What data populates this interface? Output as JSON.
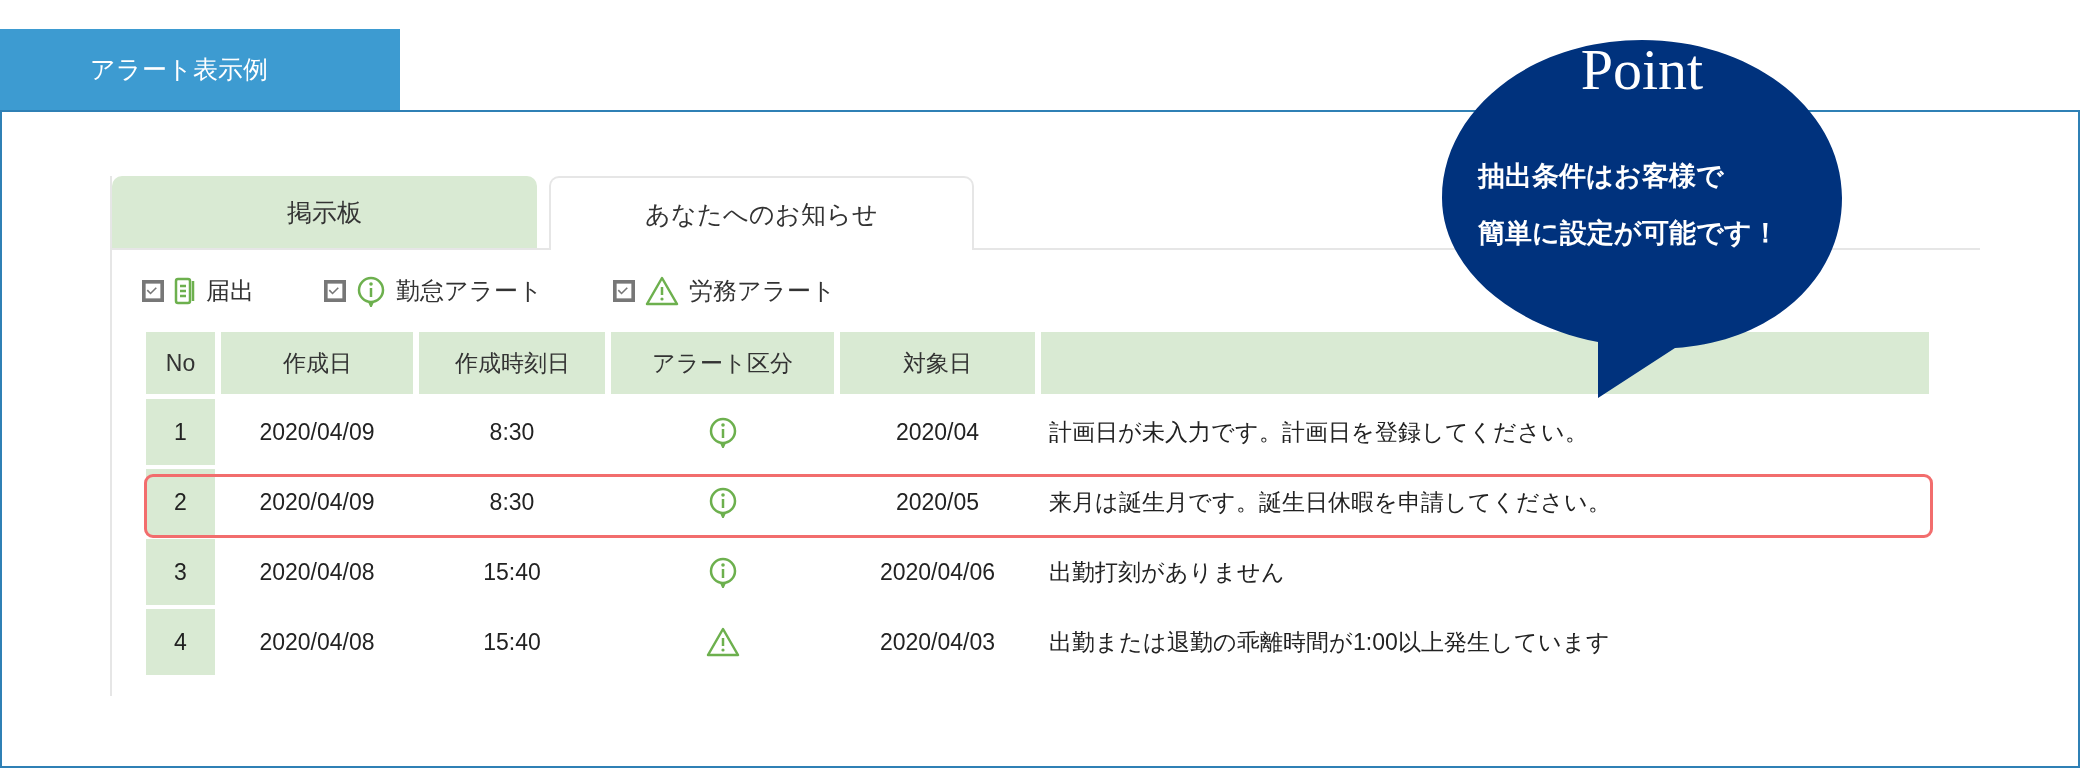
{
  "header": {
    "title": "アラート表示例"
  },
  "tabs": [
    {
      "label": "掲示板",
      "selected": false
    },
    {
      "label": "あなたへのお知らせ",
      "selected": true
    }
  ],
  "filters": [
    {
      "label": "届出",
      "kind": "document",
      "checked": true
    },
    {
      "label": "勤怠アラート",
      "kind": "info",
      "checked": true
    },
    {
      "label": "労務アラート",
      "kind": "warning",
      "checked": true
    }
  ],
  "table": {
    "columns": [
      "No",
      "作成日",
      "作成時刻日",
      "アラート区分",
      "対象日"
    ],
    "rows": [
      {
        "no": "1",
        "created_date": "2020/04/09",
        "created_time": "8:30",
        "kind": "info",
        "target_date": "2020/04",
        "message": "計画日が未入力です。計画日を登録してください。",
        "selected": false
      },
      {
        "no": "2",
        "created_date": "2020/04/09",
        "created_time": "8:30",
        "kind": "info",
        "target_date": "2020/05",
        "message": "来月は誕生月です。誕生日休暇を申請してください。",
        "selected": true
      },
      {
        "no": "3",
        "created_date": "2020/04/08",
        "created_time": "15:40",
        "kind": "info",
        "target_date": "2020/04/06",
        "message": "出勤打刻がありません",
        "selected": false
      },
      {
        "no": "4",
        "created_date": "2020/04/08",
        "created_time": "15:40",
        "kind": "warning",
        "target_date": "2020/04/03",
        "message": "出勤または退勤の乖離時間が1:00以上発生しています",
        "selected": false
      }
    ]
  },
  "point": {
    "title": "Point",
    "lines": [
      "抽出条件はお客様で",
      "簡単に設定が可能です！"
    ]
  }
}
